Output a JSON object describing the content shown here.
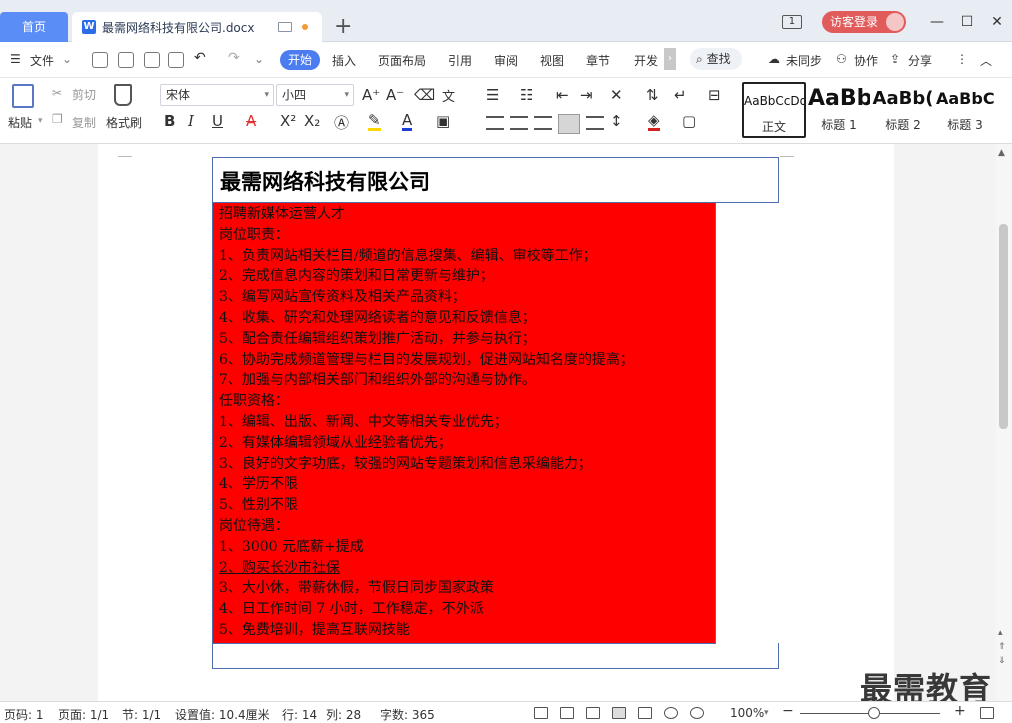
{
  "titlebar": {
    "home_tab": "首页",
    "doc_tab": "最需网络科技有限公司.docx",
    "doc_icon": "W",
    "add_tab": "+",
    "page_count_icon": "1",
    "guest_login": "访客登录",
    "minimize": "—",
    "maximize": "☐",
    "close": "✕"
  },
  "menu": {
    "file": "文件",
    "start": "开始",
    "insert": "插入",
    "page_layout": "页面布局",
    "references": "引用",
    "review": "审阅",
    "view": "视图",
    "chapter": "章节",
    "develop": "开发",
    "search": "查找",
    "not_synced": "未同步",
    "collaborate": "协作",
    "share": "分享"
  },
  "ribbon": {
    "paste": "粘贴",
    "cut": "剪切",
    "copy": "复制",
    "format_painter": "格式刷",
    "font_name": "宋体",
    "font_size": "小四",
    "styles": [
      {
        "preview": "AaBbCcDd",
        "name": "正文"
      },
      {
        "preview": "AaBb",
        "name": "标题 1"
      },
      {
        "preview": "AaBb(",
        "name": "标题 2"
      },
      {
        "preview": "AaBbC",
        "name": "标题 3"
      }
    ]
  },
  "document": {
    "company": "最需网络科技有限公司",
    "lines": [
      "招聘新媒体运营人才",
      "岗位职责：",
      "1、负责网站相关栏目/频道的信息搜集、编辑、审校等工作；",
      "2、完成信息内容的策划和日常更新与维护；",
      "3、编写网站宣传资料及相关产品资料；",
      "4、收集、研究和处理网络读者的意见和反馈信息；",
      "5、配合责任编辑组织策划推广活动，并参与执行；",
      "6、协助完成频道管理与栏目的发展规划，促进网站知名度的提高；",
      "7、加强与内部相关部门和组织外部的沟通与协作。",
      "任职资格：",
      "1、编辑、出版、新闻、中文等相关专业优先；",
      "2、有媒体编辑领域从业经验者优先；",
      "3、良好的文字功底，较强的网站专题策划和信息采编能力；",
      "4、学历不限",
      "5、性别不限",
      "岗位待遇：",
      "1、3000 元底薪+提成",
      "2、购买长沙市社保",
      "3、大小休，带薪休假，节假日同步国家政策",
      "4、日工作时间 7 小时，工作稳定，不外派",
      "5、免费培训，提高互联网技能"
    ],
    "highlight_color": "#fe0000"
  },
  "watermark": "最需教育",
  "status": {
    "page_no": "页码: 1",
    "pages": "页面: 1/1",
    "section": "节: 1/1",
    "position": "设置值: 10.4厘米",
    "row": "行: 14",
    "col": "列: 28",
    "words": "字数: 365",
    "zoom": "100%"
  },
  "colors": {
    "accent": "#4b7cf0",
    "home_tab": "#5b8df6",
    "guest": "#e25b5b",
    "table_border": "#4d6fae"
  }
}
